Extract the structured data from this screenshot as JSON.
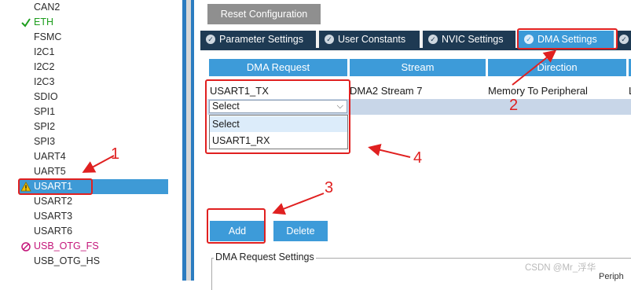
{
  "tree": {
    "items": [
      {
        "label": "CAN2",
        "state": "normal"
      },
      {
        "label": "ETH",
        "state": "ok"
      },
      {
        "label": "FSMC",
        "state": "normal"
      },
      {
        "label": "I2C1",
        "state": "normal"
      },
      {
        "label": "I2C2",
        "state": "normal"
      },
      {
        "label": "I2C3",
        "state": "normal"
      },
      {
        "label": "SDIO",
        "state": "normal"
      },
      {
        "label": "SPI1",
        "state": "normal"
      },
      {
        "label": "SPI2",
        "state": "normal"
      },
      {
        "label": "SPI3",
        "state": "normal"
      },
      {
        "label": "UART4",
        "state": "normal"
      },
      {
        "label": "UART5",
        "state": "normal"
      },
      {
        "label": "USART1",
        "state": "selected-warning"
      },
      {
        "label": "USART2",
        "state": "normal"
      },
      {
        "label": "USART3",
        "state": "normal"
      },
      {
        "label": "USART6",
        "state": "normal"
      },
      {
        "label": "USB_OTG_FS",
        "state": "error"
      },
      {
        "label": "USB_OTG_HS",
        "state": "normal"
      }
    ]
  },
  "toolbar": {
    "reset_label": "Reset Configuration"
  },
  "tabs": [
    {
      "label": "Parameter Settings",
      "active": false
    },
    {
      "label": "User Constants",
      "active": false
    },
    {
      "label": "NVIC Settings",
      "active": false
    },
    {
      "label": "DMA Settings",
      "active": true
    }
  ],
  "table": {
    "headers": [
      "DMA Request",
      "Stream",
      "Direction",
      ""
    ],
    "rows": [
      {
        "request": "USART1_TX",
        "stream": "DMA2 Stream 7",
        "direction": "Memory To Peripheral",
        "priority": "L"
      }
    ],
    "new_row_select_value": "Select",
    "dropdown_options": [
      "Select",
      "USART1_RX"
    ]
  },
  "buttons": {
    "add": "Add",
    "delete": "Delete"
  },
  "group": {
    "title": "DMA Request Settings",
    "cut_text": "Periph"
  },
  "annotations": {
    "labels": [
      "1",
      "2",
      "3",
      "4"
    ],
    "color": "#e02020"
  },
  "watermark": "CSDN @Mr_浮华",
  "colors": {
    "accent": "#3d9bd9",
    "tab_dark": "#1e3a53",
    "ok": "#1e9e1e",
    "error": "#c4167a",
    "selection": "#3e9ad6"
  }
}
